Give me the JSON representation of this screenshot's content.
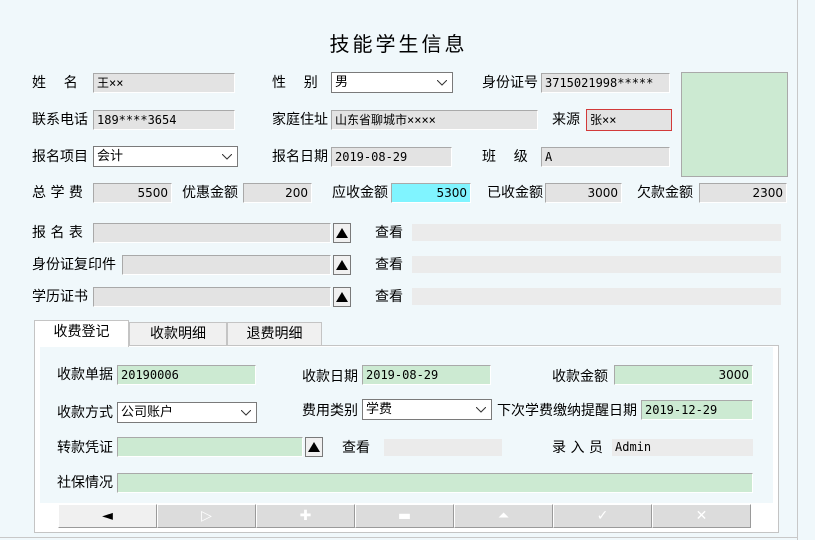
{
  "title": "技能学生信息",
  "student": {
    "name_label": "姓    名",
    "name_value": "王××",
    "gender_label": "性    别",
    "gender_value": "男",
    "id_label": "身份证号",
    "id_value": "3715021998*****",
    "phone_label": "联系电话",
    "phone_value": "189****3654",
    "address_label": "家庭住址",
    "address_value": "山东省聊城市××××",
    "source_label": "来源",
    "source_value": "张××",
    "project_label": "报名项目",
    "project_value": "会计",
    "date_label": "报名日期",
    "date_value": "2019-08-29",
    "class_label": "班    级",
    "class_value": "A"
  },
  "fees": {
    "total_label": "总 学 费",
    "total_value": "5500",
    "discount_label": "优惠金额",
    "discount_value": "200",
    "due_label": "应收金额",
    "due_value": "5300",
    "received_label": "已收金额",
    "received_value": "3000",
    "owed_label": "欠款金额",
    "owed_value": "2300"
  },
  "attachments": [
    {
      "label": "报 名 表",
      "view": "查看"
    },
    {
      "label": "身份证复印件",
      "view": "查看"
    },
    {
      "label": "学历证书",
      "view": "查看"
    }
  ],
  "tabs": [
    "收费登记",
    "收款明细",
    "退费明细"
  ],
  "payment": {
    "receipt_label": "收款单据",
    "receipt_value": "20190006",
    "pay_date_label": "收款日期",
    "pay_date_value": "2019-08-29",
    "amount_label": "收款金额",
    "amount_value": "3000",
    "method_label": "收款方式",
    "method_value": "公司账户",
    "fee_type_label": "费用类别",
    "fee_type_value": "学费",
    "reminder_label": "下次学费缴纳提醒日期",
    "reminder_value": "2019-12-29",
    "voucher_label": "转款凭证",
    "voucher_view": "查看",
    "operator_label": "录 入 员",
    "operator_value": "Admin",
    "social_label": "社保情况"
  },
  "nav": [
    "◄",
    "▷",
    "✚",
    "▬",
    "⏶",
    "✓",
    "✕"
  ],
  "icons": {
    "dropdown": "chevron-down-icon",
    "upload": "triangle-up-icon"
  },
  "colors": {
    "background": "#f0f8fb",
    "field_gray": "#e3e3e3",
    "field_green": "#ccead2",
    "field_cyan": "#80f4ff",
    "source_border": "#d23a3a"
  }
}
